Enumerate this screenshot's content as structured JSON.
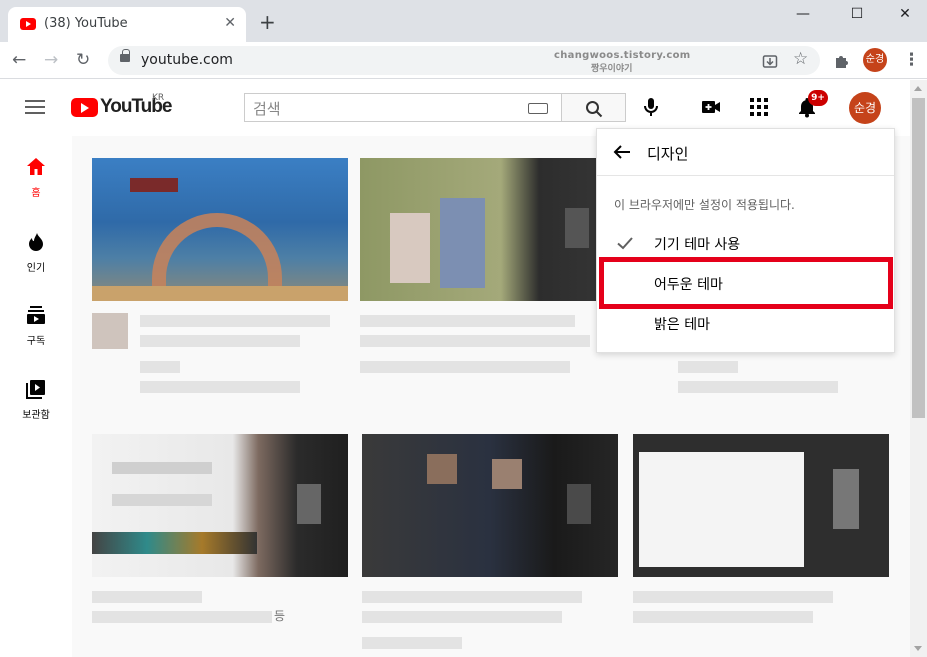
{
  "browser": {
    "tab_title": "(38) YouTube",
    "url": "youtube.com",
    "watermark_line1": "changwoos.tistory.com",
    "watermark_line2": "짱우이야기",
    "profile_initials": "순경"
  },
  "header": {
    "logo_text": "YouTube",
    "logo_region": "KR",
    "search_placeholder": "검색",
    "notification_count": "9+",
    "avatar_initials": "순경"
  },
  "guide": {
    "items": [
      {
        "label": "홈",
        "icon": "home-icon"
      },
      {
        "label": "인기",
        "icon": "fire-icon"
      },
      {
        "label": "구독",
        "icon": "subscriptions-icon"
      },
      {
        "label": "보관함",
        "icon": "library-icon"
      }
    ]
  },
  "menu": {
    "title": "디자인",
    "note": "이 브라우저에만 설정이 적용됩니다.",
    "options": [
      {
        "label": "기기 테마 사용",
        "selected": true
      },
      {
        "label": "어두운 테마",
        "selected": false
      },
      {
        "label": "밝은 테마",
        "selected": false
      }
    ]
  },
  "content": {
    "trailing_char": "등"
  },
  "colors": {
    "brand_red": "#ff0000",
    "highlight_red": "#e5001a",
    "avatar": "#c5431a"
  }
}
